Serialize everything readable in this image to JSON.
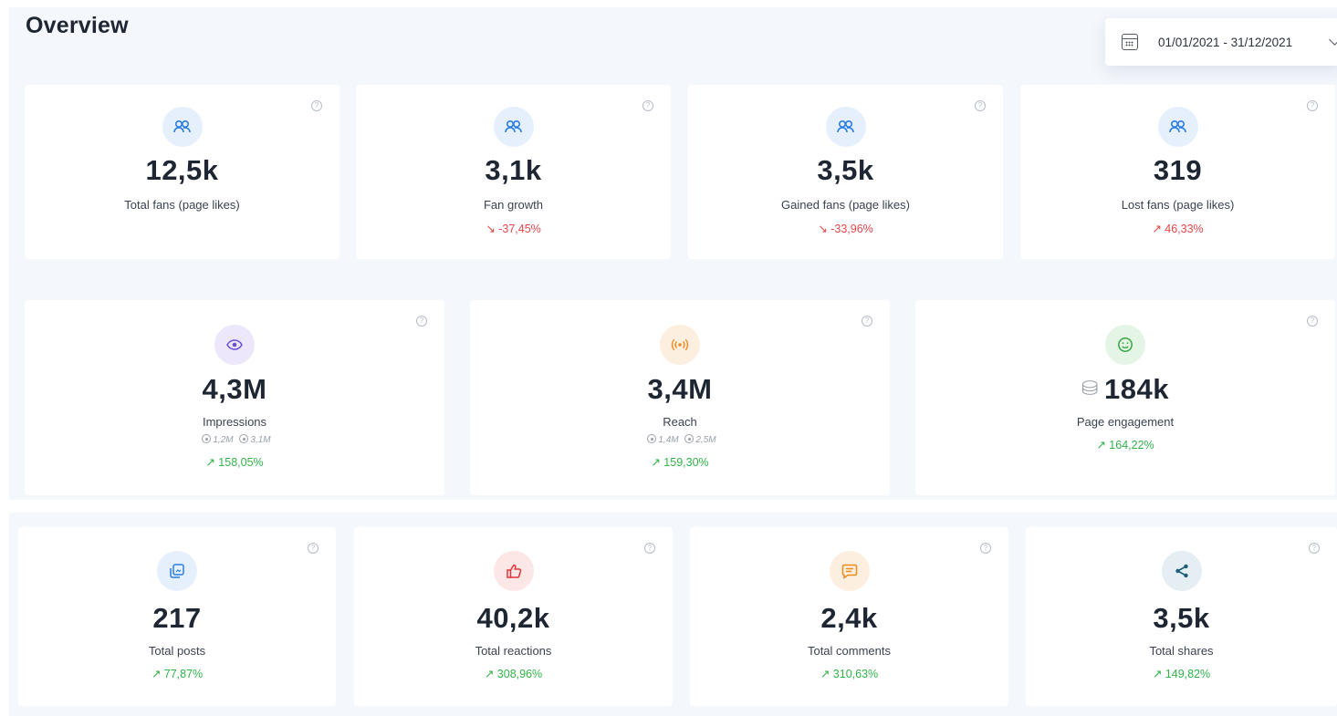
{
  "header": {
    "title": "Overview"
  },
  "date_range": {
    "value": "01/01/2021 - 31/12/2021"
  },
  "help_glyph": "?",
  "row1": [
    {
      "value": "12,5k",
      "label": "Total fans (page likes)",
      "delta": "",
      "trend": ""
    },
    {
      "value": "3,1k",
      "label": "Fan growth",
      "delta": "-37,45%",
      "trend": "down"
    },
    {
      "value": "3,5k",
      "label": "Gained fans (page likes)",
      "delta": "-33,96%",
      "trend": "down"
    },
    {
      "value": "319",
      "label": "Lost fans (page likes)",
      "delta": "46,33%",
      "trend": "up"
    }
  ],
  "row2": [
    {
      "value": "4,3M",
      "label": "Impressions",
      "organic": "1,2M",
      "paid": "3,1M",
      "delta": "158,05%",
      "trend": "up"
    },
    {
      "value": "3,4M",
      "label": "Reach",
      "organic": "1,4M",
      "paid": "2,5M",
      "delta": "159,30%",
      "trend": "up"
    },
    {
      "value": "184k",
      "label": "Page engagement",
      "delta": "164,22%",
      "trend": "up"
    }
  ],
  "row3": [
    {
      "value": "217",
      "label": "Total posts",
      "delta": "77,87%",
      "trend": "up"
    },
    {
      "value": "40,2k",
      "label": "Total reactions",
      "delta": "308,96%",
      "trend": "up"
    },
    {
      "value": "2,4k",
      "label": "Total comments",
      "delta": "310,63%",
      "trend": "up"
    },
    {
      "value": "3,5k",
      "label": "Total shares",
      "delta": "149,82%",
      "trend": "up"
    }
  ],
  "arrows": {
    "up": "↗",
    "down": "↘"
  },
  "colors": {
    "up": "#32b34a",
    "down": "#e8474a",
    "blue": "#2a7de1",
    "purple": "#6b4fd8",
    "orange": "#f08a1c",
    "green": "#3aa845",
    "red": "#e0353a",
    "teal": "#1d5c7a"
  }
}
